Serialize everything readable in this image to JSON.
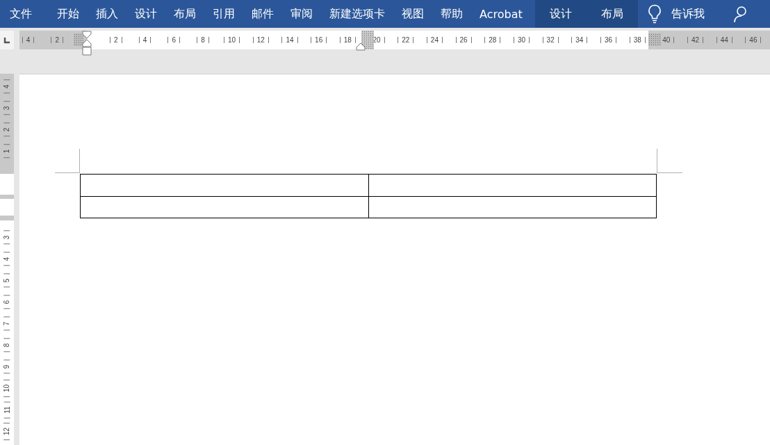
{
  "ribbon": {
    "tabs": [
      {
        "label": "文件",
        "kind": "file"
      },
      {
        "label": "开始",
        "kind": "normal"
      },
      {
        "label": "插入",
        "kind": "normal"
      },
      {
        "label": "设计",
        "kind": "normal"
      },
      {
        "label": "布局",
        "kind": "normal"
      },
      {
        "label": "引用",
        "kind": "normal"
      },
      {
        "label": "邮件",
        "kind": "normal"
      },
      {
        "label": "审阅",
        "kind": "normal"
      },
      {
        "label": "新建选项卡",
        "kind": "normal"
      },
      {
        "label": "视图",
        "kind": "normal"
      },
      {
        "label": "帮助",
        "kind": "normal"
      },
      {
        "label": "Acrobat",
        "kind": "normal"
      },
      {
        "label": "设计",
        "kind": "contextual"
      },
      {
        "label": "布局",
        "kind": "contextual"
      }
    ],
    "tell_me": {
      "label": "告诉我"
    }
  },
  "horizontal_ruler": {
    "left_margin_labels": [
      "4",
      "2"
    ],
    "body_labels": [
      "2",
      "4",
      "6",
      "8",
      "10",
      "12",
      "14",
      "16",
      "18",
      "20",
      "22",
      "24",
      "26",
      "28",
      "30",
      "32",
      "34",
      "36",
      "38"
    ],
    "right_margin_labels": [
      "40",
      "42",
      "44",
      "46"
    ]
  },
  "vertical_ruler": {
    "top_margin_labels": [
      "4",
      "3",
      "2",
      "1"
    ],
    "body_labels": [
      "3",
      "4",
      "5",
      "6",
      "7",
      "8",
      "9",
      "10",
      "11",
      "12"
    ]
  },
  "document": {
    "table": {
      "rows": [
        {
          "cells": [
            {
              "selected": false
            },
            {
              "selected": false
            }
          ]
        },
        {
          "cells": [
            {
              "selected": false
            },
            {
              "selected": false
            }
          ]
        }
      ]
    }
  }
}
